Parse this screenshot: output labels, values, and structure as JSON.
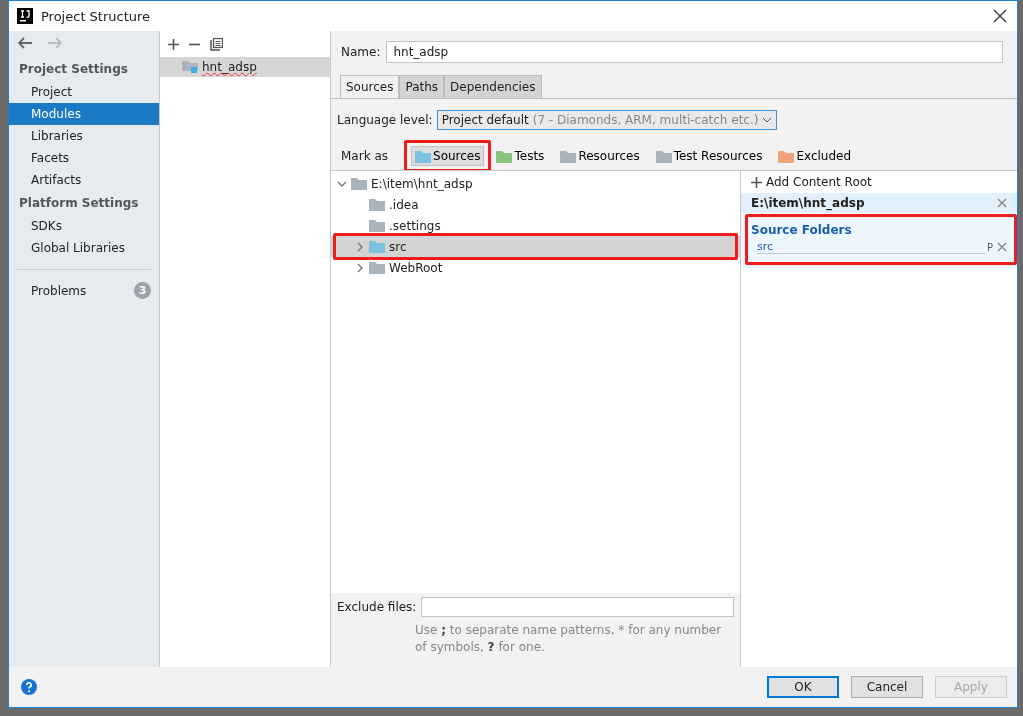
{
  "window": {
    "title": "Project Structure"
  },
  "sidebar": {
    "sections": [
      {
        "title": "Project Settings",
        "items": [
          {
            "label": "Project",
            "selected": false
          },
          {
            "label": "Modules",
            "selected": true
          },
          {
            "label": "Libraries",
            "selected": false
          },
          {
            "label": "Facets",
            "selected": false
          },
          {
            "label": "Artifacts",
            "selected": false
          }
        ]
      },
      {
        "title": "Platform Settings",
        "items": [
          {
            "label": "SDKs",
            "selected": false
          },
          {
            "label": "Global Libraries",
            "selected": false
          }
        ]
      }
    ],
    "problems": {
      "label": "Problems",
      "count": "3"
    }
  },
  "modules": [
    {
      "name": "hnt_adsp",
      "selected": true
    }
  ],
  "name_field": {
    "label": "Name:",
    "value": "hnt_adsp"
  },
  "tabs": [
    {
      "label": "Sources",
      "selected": true
    },
    {
      "label": "Paths",
      "selected": false
    },
    {
      "label": "Dependencies",
      "selected": false
    }
  ],
  "language_level": {
    "label": "Language level:",
    "value": "Project default",
    "hint": "(7 - Diamonds, ARM, multi-catch etc.)"
  },
  "mark_as": {
    "label": "Mark as",
    "items": [
      {
        "label": "Sources",
        "color": "#7ac2e0",
        "selected": true,
        "highlighted": true
      },
      {
        "label": "Tests",
        "color": "#8bc47f",
        "selected": false,
        "highlighted": false
      },
      {
        "label": "Resources",
        "color": "#a9b3bb",
        "selected": false,
        "highlighted": false
      },
      {
        "label": "Test Resources",
        "color": "#a9b3bb",
        "selected": false,
        "highlighted": false
      },
      {
        "label": "Excluded",
        "color": "#f0a47e",
        "selected": false,
        "highlighted": false
      }
    ]
  },
  "tree": [
    {
      "label": "E:\\item\\hnt_adsp",
      "expanded": true,
      "source": false,
      "selected": false,
      "highlighted": false,
      "children": [
        {
          "label": ".idea",
          "source": false,
          "selected": false,
          "highlighted": false
        },
        {
          "label": ".settings",
          "source": false,
          "selected": false,
          "highlighted": false
        },
        {
          "label": "src",
          "expanded": false,
          "expandable": true,
          "source": true,
          "selected": true,
          "highlighted": true
        },
        {
          "label": "WebRoot",
          "expanded": false,
          "expandable": true,
          "source": false,
          "selected": false,
          "highlighted": false
        }
      ]
    }
  ],
  "content_root": {
    "add_label": "Add Content Root",
    "path": "E:\\item\\hnt_adsp",
    "source_folders": {
      "title": "Source Folders",
      "highlighted": true,
      "items": [
        {
          "name": "src",
          "prefix_button": "P"
        }
      ]
    }
  },
  "exclude": {
    "label": "Exclude files:",
    "help": "Use **;** to separate name patterns, * for any number of symbols, **?** for one."
  },
  "buttons": [
    {
      "label": "OK",
      "kind": "default",
      "disabled": false
    },
    {
      "label": "Cancel",
      "kind": "normal",
      "disabled": false
    },
    {
      "label": "Apply",
      "kind": "normal",
      "disabled": true
    }
  ]
}
